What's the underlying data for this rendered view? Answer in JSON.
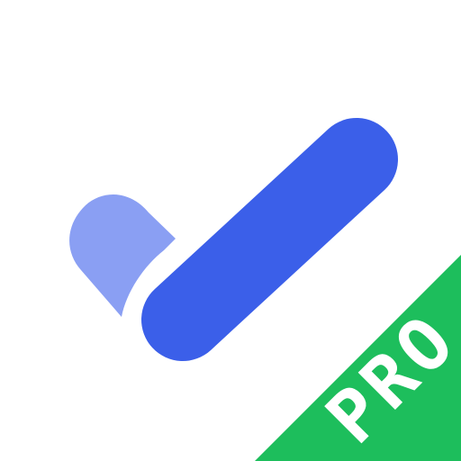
{
  "app_icon": {
    "badge": {
      "label": "PRO",
      "color": "#1DBE5C",
      "text_color": "#FFFFFF"
    },
    "checkmark": {
      "long_stroke_color": "#3B5FE9",
      "short_stroke_color": "#8A9FF3"
    },
    "background_color": "#FFFFFF"
  }
}
